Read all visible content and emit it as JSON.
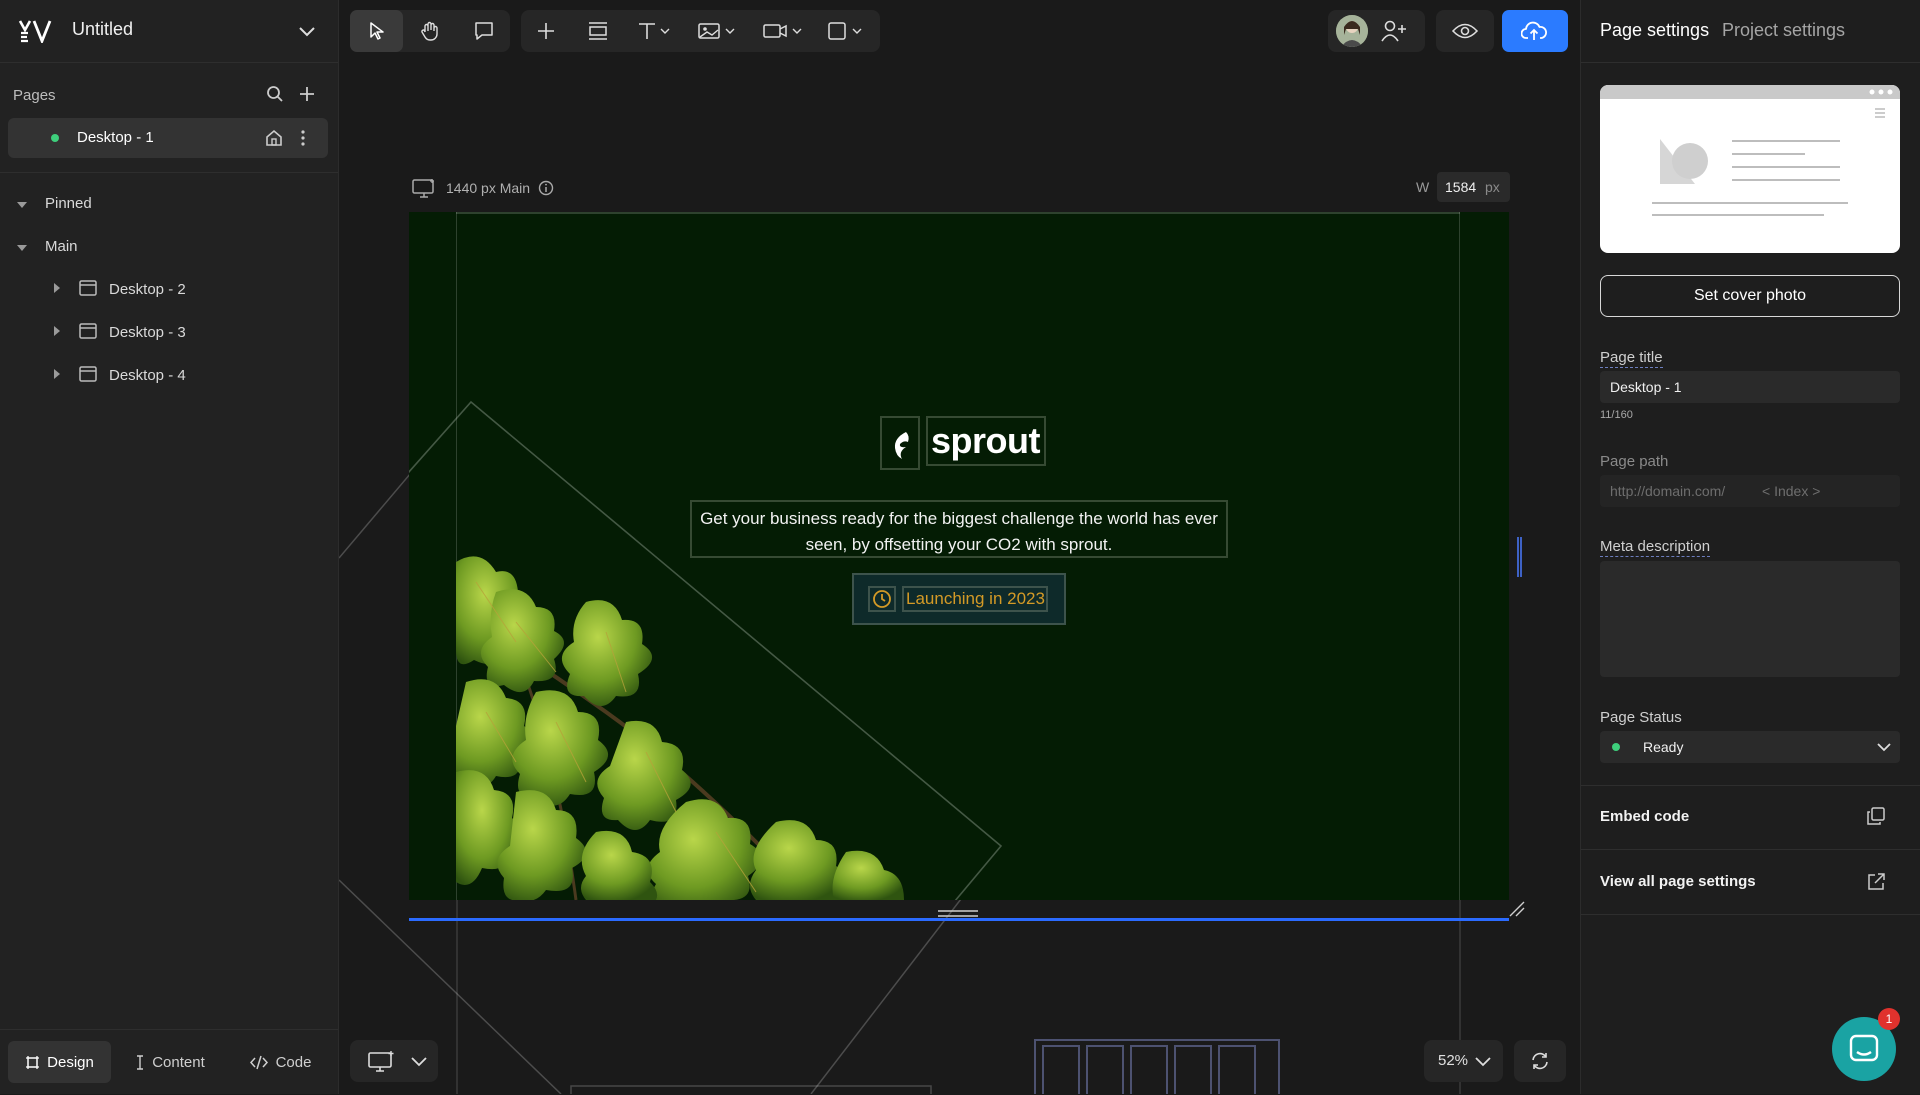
{
  "app": {
    "logo": "V E V",
    "project_title": "Untitled"
  },
  "sidebar": {
    "pages_label": "Pages",
    "active_page": "Desktop - 1",
    "groups": [
      {
        "label": "Pinned"
      },
      {
        "label": "Main"
      }
    ],
    "main_pages": [
      "Desktop - 2",
      "Desktop - 3",
      "Desktop - 4"
    ],
    "modes": [
      {
        "label": "Design",
        "active": true
      },
      {
        "label": "Content",
        "active": false
      },
      {
        "label": "Code",
        "active": false
      }
    ]
  },
  "toolbar": {
    "tools": [
      "select-icon",
      "hand-icon",
      "comment-icon",
      "add-icon",
      "section-icon",
      "text-icon",
      "image-icon",
      "video-icon",
      "shape-icon"
    ],
    "right": [
      "avatar",
      "add-user-icon",
      "preview-icon",
      "publish-icon"
    ]
  },
  "canvas": {
    "breakpoint_label": "1440 px Main",
    "width_label": "W",
    "width_value": "1584",
    "width_unit": "px",
    "zoom": "52%",
    "content": {
      "brand": "sprout",
      "tagline": "Get your business ready for the biggest challenge the world has ever seen, by offsetting your CO2 with sprout.",
      "badge": "Launching in 2023"
    }
  },
  "right_panel": {
    "tabs": [
      {
        "label": "Page settings",
        "active": true
      },
      {
        "label": "Project settings",
        "active": false
      }
    ],
    "cover_button": "Set cover photo",
    "page_title_label": "Page title",
    "page_title_value": "Desktop - 1",
    "page_title_count": "11/160",
    "page_path_label": "Page path",
    "page_path_domain": "http://domain.com/",
    "page_path_value": "< Index >",
    "meta_label": "Meta description",
    "meta_value": "",
    "status_label": "Page Status",
    "status_value": "Ready",
    "embed_label": "Embed code",
    "view_all_label": "View all page settings"
  },
  "chat": {
    "badge_count": "1"
  },
  "colors": {
    "accent": "#2b7bff",
    "frame_bg": "#041c04",
    "badge_text": "#d49a26",
    "status_dot": "#3ecf7c",
    "chat": "#1aa3a3"
  }
}
